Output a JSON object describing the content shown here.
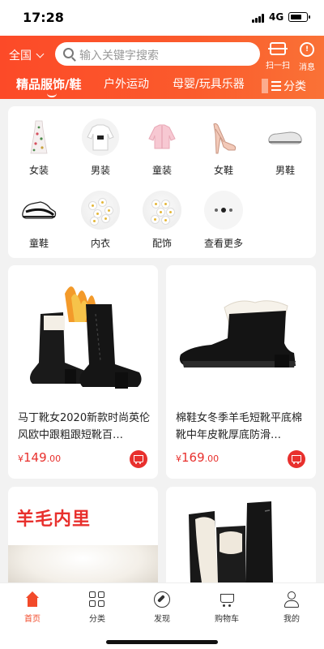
{
  "status_bar": {
    "time": "17:28",
    "network": "4G"
  },
  "header": {
    "region": "全国",
    "search_placeholder": "输入关键字搜索",
    "scan_label": "扫一扫",
    "message_label": "消息",
    "tabs": [
      "精品服饰/鞋",
      "户外运动",
      "母婴/玩具乐器"
    ],
    "more_label": "分类"
  },
  "categories": [
    {
      "label": "女装",
      "icon": "dress-icon"
    },
    {
      "label": "男装",
      "icon": "sweater-icon"
    },
    {
      "label": "童装",
      "icon": "kids-jacket-icon"
    },
    {
      "label": "女鞋",
      "icon": "heels-icon"
    },
    {
      "label": "男鞋",
      "icon": "loafer-icon"
    },
    {
      "label": "童鞋",
      "icon": "sneaker-icon"
    },
    {
      "label": "内衣",
      "icon": "flowers-icon"
    },
    {
      "label": "配饰",
      "icon": "flowers-icon"
    },
    {
      "label": "查看更多",
      "icon": "more-dots-icon"
    }
  ],
  "products": [
    {
      "title": "马丁靴女2020新款时尚英伦风欧中跟粗跟短靴百…",
      "price_main": "149",
      "price_decimal": ".00"
    },
    {
      "title": "棉鞋女冬季羊毛短靴平底棉靴中年皮靴厚底防滑…",
      "price_main": "169",
      "price_decimal": ".00"
    }
  ],
  "promo_card": {
    "banner": "羊毛内里"
  },
  "bottom_nav": [
    {
      "label": "首页",
      "active": true
    },
    {
      "label": "分类",
      "active": false
    },
    {
      "label": "发现",
      "active": false
    },
    {
      "label": "购物车",
      "active": false
    },
    {
      "label": "我的",
      "active": false
    }
  ],
  "colors": {
    "accent": "#fc4a28",
    "price": "#e8302d",
    "nav_active": "#f24a2a"
  }
}
